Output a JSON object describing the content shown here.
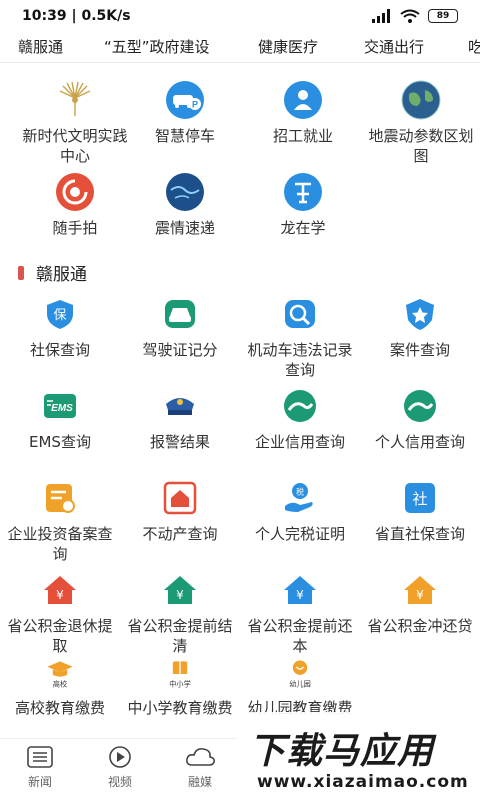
{
  "status": {
    "time": "10:39",
    "speed": "0.5K/s",
    "battery": "89"
  },
  "tabs": [
    "赣服通",
    "“五型”政府建设",
    "健康医疗",
    "交通出行",
    "吃"
  ],
  "top_services": [
    {
      "label": "新时代文明实践中心",
      "icon": "peacock-emblem-icon"
    },
    {
      "label": "智慧停车",
      "icon": "parking-car-icon"
    },
    {
      "label": "招工就业",
      "icon": "person-badge-icon"
    },
    {
      "label": "地震动参数区划图",
      "icon": "earth-globe-icon"
    },
    {
      "label": "随手拍",
      "icon": "camera-snap-icon"
    },
    {
      "label": "震情速递",
      "icon": "seismic-globe-icon"
    },
    {
      "label": "龙在学",
      "icon": "learn-char-icon"
    }
  ],
  "section": {
    "title": "赣服通"
  },
  "gfw_services": [
    {
      "label": "社保查询",
      "icon": "shield-insurance-icon",
      "badge": "保"
    },
    {
      "label": "驾驶证记分",
      "icon": "car-icon",
      "badge": ""
    },
    {
      "label": "机动车违法记录查询",
      "icon": "car-search-icon",
      "badge": ""
    },
    {
      "label": "案件查询",
      "icon": "police-badge-icon",
      "badge": ""
    },
    {
      "label": "EMS查询",
      "icon": "ems-icon",
      "badge": "EMS"
    },
    {
      "label": "报警结果",
      "icon": "police-cap-icon",
      "badge": ""
    },
    {
      "label": "企业信用查询",
      "icon": "credit-wave-icon",
      "badge": ""
    },
    {
      "label": "个人信用查询",
      "icon": "credit-wave-icon",
      "badge": ""
    },
    {
      "label": "企业投资备案查询",
      "icon": "document-coin-icon",
      "badge": ""
    },
    {
      "label": "不动产查询",
      "icon": "house-icon",
      "badge": ""
    },
    {
      "label": "个人完税证明",
      "icon": "tax-hand-icon",
      "badge": "税"
    },
    {
      "label": "省直社保查询",
      "icon": "social-security-icon",
      "badge": "社"
    },
    {
      "label": "省公积金退休提取",
      "icon": "fund-house-icon",
      "badge": "¥"
    },
    {
      "label": "省公积金提前结清",
      "icon": "fund-house-icon",
      "badge": "¥"
    },
    {
      "label": "省公积金提前还本",
      "icon": "fund-house-icon",
      "badge": "¥"
    },
    {
      "label": "省公积金冲还贷",
      "icon": "fund-house-icon",
      "badge": "¥"
    },
    {
      "label": "高校教育缴费",
      "icon": "graduation-cap-icon",
      "badge": "高校"
    },
    {
      "label": "中小学教育缴费",
      "icon": "book-icon",
      "badge": "中小学"
    },
    {
      "label": "幼儿园教育缴费",
      "icon": "kindergarten-icon",
      "badge": "幼儿园"
    }
  ],
  "bottom_nav": [
    {
      "label": "新闻",
      "icon": "news-list-icon"
    },
    {
      "label": "视频",
      "icon": "video-play-icon"
    },
    {
      "label": "融媒",
      "icon": "cloud-icon"
    }
  ],
  "watermark": {
    "title": "下载马应用",
    "url": "www.xiazaimao.com"
  },
  "colors": {
    "accent_red": "#d9534f",
    "blue": "#2a8fe0",
    "red": "#e5503a",
    "green": "#1c9a75",
    "orange": "#f0a12a"
  }
}
